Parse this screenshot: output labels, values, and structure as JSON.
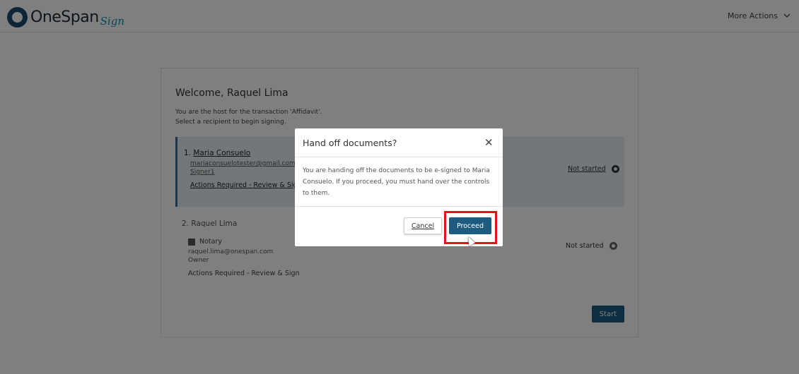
{
  "header": {
    "logo_text": "OneSpan",
    "logo_sub": "Sign",
    "more_actions": "More Actions"
  },
  "card": {
    "welcome": "Welcome, Raquel Lima",
    "intro_line1": "You are the host for the transaction 'Affidavit'.",
    "intro_line2": "Select a recipient to begin signing.",
    "recipients": [
      {
        "index": "1.",
        "name": "Maria Consuelo",
        "email": "mariaconsuelotester@gmail.com",
        "role": "Signer1",
        "actions": "Actions Required - Review & Sign",
        "status": "Not started"
      },
      {
        "index": "2.",
        "name": "Raquel Lima",
        "badge": "Notary",
        "email": "raquel.lima@onespan.com",
        "role": "Owner",
        "actions": "Actions Required - Review & Sign",
        "status": "Not started"
      }
    ],
    "start_label": "Start"
  },
  "dialog": {
    "title": "Hand off documents?",
    "close_symbol": "✕",
    "body": "You are handing off the documents to be e-signed to Maria Consuelo. If you proceed, you must hand over the controls to them.",
    "cancel_label": "Cancel",
    "proceed_label": "Proceed"
  },
  "colors": {
    "brand": "#1e5b80",
    "highlight": "#e0141b"
  }
}
